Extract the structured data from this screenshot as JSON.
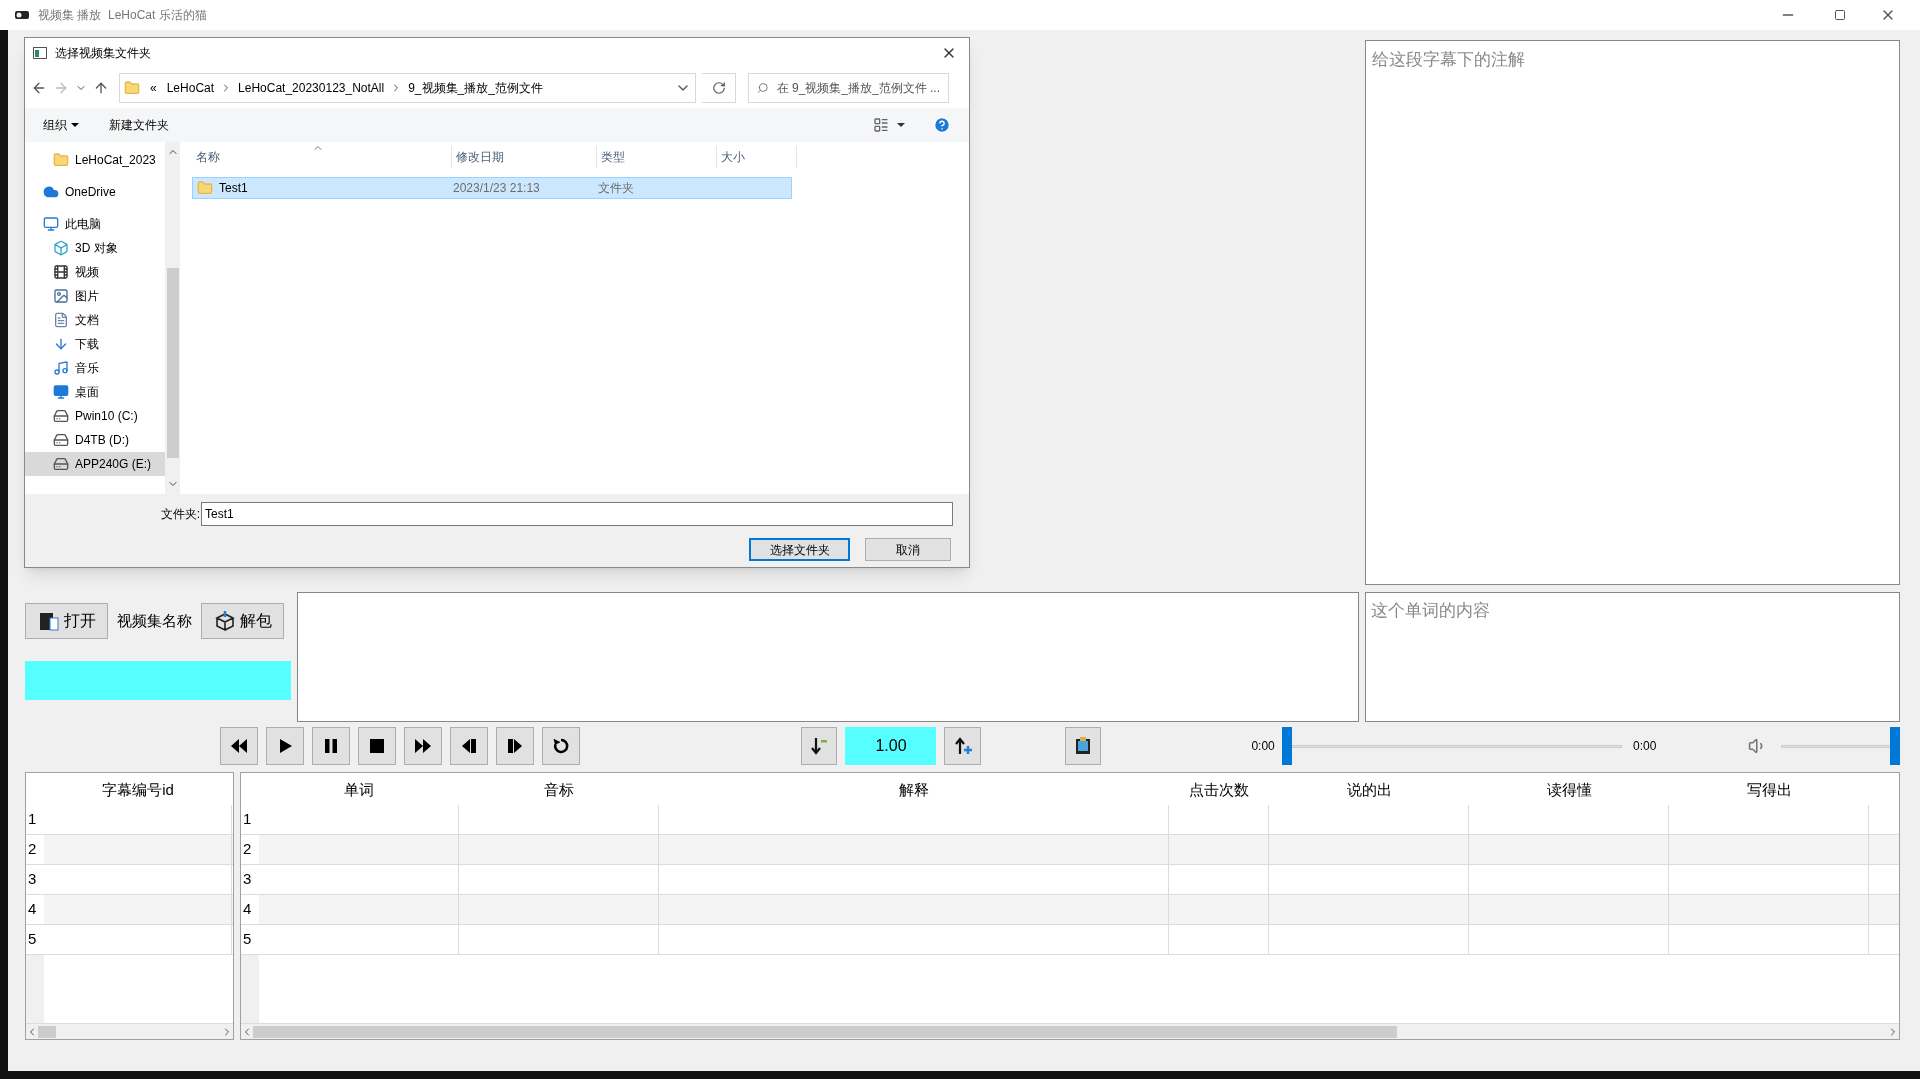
{
  "window": {
    "title": "视频集 播放  LeHoCat 乐活的猫"
  },
  "dialog": {
    "title": "选择视频集文件夹",
    "breadcrumb": [
      "«",
      "LeHoCat",
      "LeHoCat_20230123_NotAll",
      "9_视频集_播放_范例文件"
    ],
    "search": {
      "placeholder": "在 9_视频集_播放_范例文件 ..."
    },
    "toolbar": [
      "组织",
      "新建文件夹"
    ],
    "nav": [
      {
        "label": "LeHoCat_2023",
        "kind": "folder",
        "selected": false
      },
      {
        "label": "OneDrive",
        "kind": "cloud",
        "selected": false
      },
      {
        "label": "此电脑",
        "kind": "pc",
        "selected": false,
        "children": [
          {
            "label": "3D 对象",
            "kind": "cube",
            "selected": false
          },
          {
            "label": "视频",
            "kind": "film",
            "selected": false
          },
          {
            "label": "图片",
            "kind": "image",
            "selected": false
          },
          {
            "label": "文档",
            "kind": "doc",
            "selected": false
          },
          {
            "label": "下载",
            "kind": "download",
            "selected": false
          },
          {
            "label": "音乐",
            "kind": "music",
            "selected": false
          },
          {
            "label": "桌面",
            "kind": "desktop",
            "selected": false
          },
          {
            "label": "Pwin10 (C:)",
            "kind": "drive",
            "selected": false
          },
          {
            "label": "D4TB (D:)",
            "kind": "drive",
            "selected": false
          },
          {
            "label": "APP240G (E:)",
            "kind": "drive",
            "selected": true
          }
        ]
      }
    ],
    "columns": [
      "名称",
      "修改日期",
      "类型",
      "大小"
    ],
    "files": [
      {
        "name": "Test1",
        "date": "2023/1/23 21:13",
        "type": "文件夹",
        "selected": true
      }
    ],
    "folder_field": {
      "label": "文件夹:",
      "value": "Test1"
    },
    "buttons": [
      {
        "label": "选择文件夹",
        "kind": "primary"
      },
      {
        "label": "取消",
        "kind": "normal"
      }
    ]
  },
  "annotation": {
    "placeholder": "给这段字幕下的注解"
  },
  "open_button": "打开",
  "collection_label": "视频集名称",
  "unpack_button": "解包",
  "word_content": {
    "placeholder": "这个单词的内容"
  },
  "speed": "1.00",
  "position": {
    "start": "0:00",
    "end": "0:00",
    "level": 0
  },
  "volume": {
    "level": 1
  },
  "subtitle_table": {
    "columns": [
      "字幕编号id"
    ],
    "rows": [
      "1",
      "2",
      "3",
      "4",
      "5"
    ]
  },
  "word_table": {
    "columns": [
      "单词",
      "音标",
      "解释",
      "点击次数",
      "说的出",
      "读得懂",
      "写得出"
    ],
    "rows": [
      "1",
      "2",
      "3",
      "4",
      "5"
    ]
  }
}
